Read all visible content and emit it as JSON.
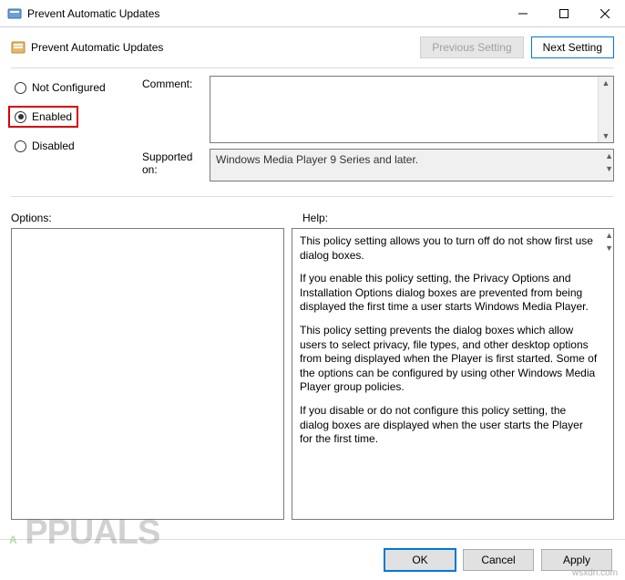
{
  "window": {
    "title": "Prevent Automatic Updates"
  },
  "header": {
    "policy_title": "Prevent Automatic Updates",
    "prev_btn": "Previous Setting",
    "next_btn": "Next Setting"
  },
  "state": {
    "not_configured": "Not Configured",
    "enabled": "Enabled",
    "disabled": "Disabled"
  },
  "labels": {
    "comment": "Comment:",
    "supported": "Supported on:",
    "options": "Options:",
    "help": "Help:"
  },
  "supported_text": "Windows Media Player 9 Series and later.",
  "help_paragraphs": [
    "This policy setting allows you to turn off do not show first use dialog boxes.",
    "If you enable this policy setting, the Privacy Options and Installation Options dialog boxes are prevented from being displayed the first time a user starts Windows Media Player.",
    "This policy setting prevents the dialog boxes which allow users to select privacy, file types, and other desktop options from being displayed when the Player is first started. Some of the options can be configured by using other Windows Media Player group policies.",
    "If you disable or do not configure this policy setting, the dialog boxes are displayed when the user starts the Player for the first time."
  ],
  "footer": {
    "ok": "OK",
    "cancel": "Cancel",
    "apply": "Apply"
  },
  "watermark": "A PPUALS",
  "credit": "wsxdn.com"
}
